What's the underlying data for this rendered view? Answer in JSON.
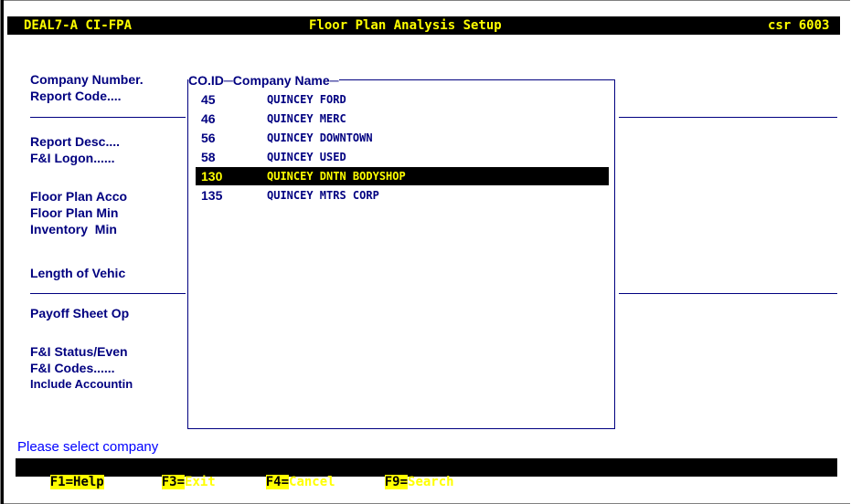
{
  "title_bar": {
    "left": "DEAL7-A CI-FPA",
    "center": "Floor Plan Analysis Setup",
    "right": "csr 6003"
  },
  "form_labels": [
    "Company Number.",
    "Report Code....",
    "Report Desc....",
    "F&I Logon......",
    "Floor Plan Acco",
    "Floor Plan Min",
    "Inventory  Min",
    "Length of Vehic",
    "Payoff Sheet Op",
    "F&I Status/Even",
    "F&I Codes......",
    "Include Accountin"
  ],
  "popup": {
    "header": "CO.ID─Company Name─",
    "rows": [
      {
        "id": "45",
        "name": "QUINCEY FORD",
        "selected": false
      },
      {
        "id": "46",
        "name": "QUINCEY MERC",
        "selected": false
      },
      {
        "id": "56",
        "name": "QUINCEY DOWNTOWN",
        "selected": false
      },
      {
        "id": "58",
        "name": "QUINCEY USED",
        "selected": false
      },
      {
        "id": "130",
        "name": "QUINCEY DNTN BODYSHOP",
        "selected": true
      },
      {
        "id": "135",
        "name": "QUINCEY MTRS CORP",
        "selected": false
      }
    ]
  },
  "status_message": "Please select company",
  "function_keys": [
    {
      "key": "F1=",
      "label": "Help"
    },
    {
      "key": "F3=",
      "label": "Exit"
    },
    {
      "key": "F4=",
      "label": "Cancel"
    },
    {
      "key": "F9=",
      "label": "Search"
    }
  ],
  "colors": {
    "label": "#000080",
    "highlight_text": "#ffff00",
    "bar": "#000000",
    "status": "#0000ff"
  }
}
